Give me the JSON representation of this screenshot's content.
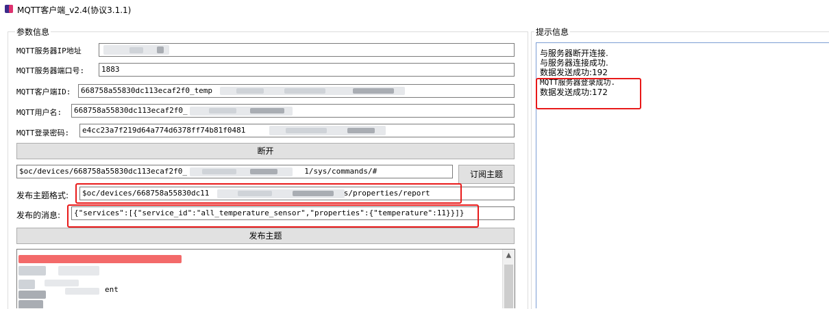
{
  "window": {
    "title": "MQTT客户端_v2.4(协议3.1.1)",
    "icon": "app-icon"
  },
  "params": {
    "legend": "参数信息",
    "server_ip": {
      "label": "MQTT服务器IP地址",
      "value": ""
    },
    "server_port": {
      "label": "MQTT服务器端口号:",
      "value": "1883"
    },
    "client_id": {
      "label": "MQTT客户端ID:",
      "value": "668758a55830dc113ecaf2f0_temp"
    },
    "username": {
      "label": "MQTT用户名:",
      "value": "668758a55830dc113ecaf2f0_"
    },
    "password": {
      "label": "MQTT登录密码:",
      "value": "e4cc23a7f219d64a774d6378ff74b81f0481"
    },
    "disconnect_button": "断开",
    "subscribe_topic": {
      "value_prefix": "$oc/devices/668758a55830dc113ecaf2f0_",
      "value_suffix": "1/sys/commands/#"
    },
    "subscribe_button": "订阅主题",
    "publish_topic": {
      "label": "发布主题格式:",
      "value_prefix": "$oc/devices/668758a55830dc11",
      "value_suffix": "01/sys/properties/report"
    },
    "publish_message": {
      "label": "发布的消息:",
      "value": "{\"services\":[{\"service_id\":\"all_temperature_sensor\",\"properties\":{\"temperature\":11}}]}"
    },
    "publish_button": "发布主题",
    "received_partial": "ent"
  },
  "tips": {
    "legend": "提示信息",
    "lines": [
      "与服务器断开连接.",
      "与服务器连接成功.",
      "数据发送成功:192",
      "MQTT服务器登录成功.",
      "数据发送成功:172"
    ]
  },
  "colors": {
    "highlight": "#e81818",
    "button_bg": "#e1e1e1"
  }
}
